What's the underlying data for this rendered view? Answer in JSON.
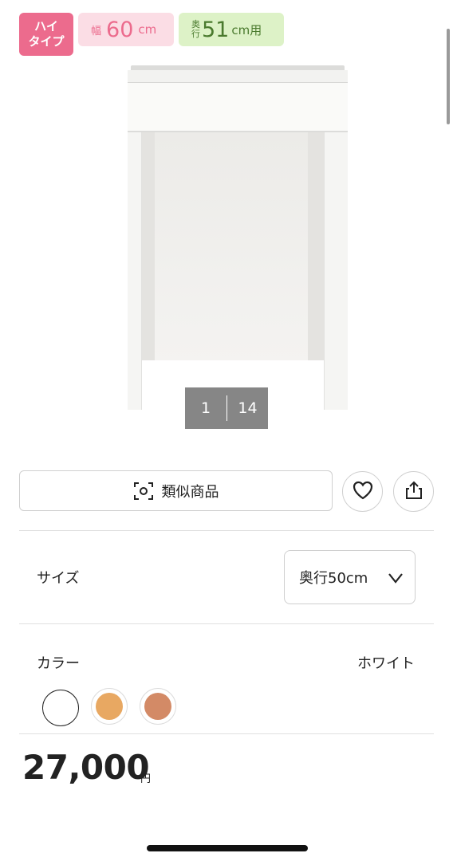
{
  "badges": {
    "type_line1": "ハイ",
    "type_line2": "タイプ",
    "width_prefix": "幅",
    "width_value": "60",
    "width_unit": "cm",
    "depth_top": "奥",
    "depth_bottom": "行",
    "depth_value": "51",
    "depth_unit": "cm用"
  },
  "gallery": {
    "current": "1",
    "total": "14"
  },
  "actions": {
    "similar_label": "類似商品"
  },
  "size": {
    "label": "サイズ",
    "selected": "奥行50cm"
  },
  "color": {
    "label": "カラー",
    "selected": "ホワイト",
    "swatches": [
      "#ffffff",
      "#e8a862",
      "#d38a66"
    ]
  },
  "price": {
    "value": "27,000",
    "unit": "円"
  },
  "icons": [
    "scan-icon",
    "heart-icon",
    "share-icon",
    "chevron-down-icon"
  ]
}
